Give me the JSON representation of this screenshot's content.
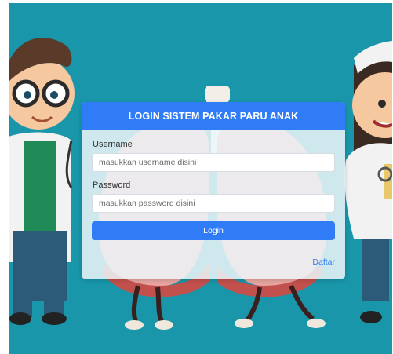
{
  "login": {
    "title": "LOGIN SISTEM PAKAR PARU ANAK",
    "username_label": "Username",
    "username_placeholder": "masukkan username disini",
    "password_label": "Password",
    "password_placeholder": "masukkan password disini",
    "login_button": "Login",
    "register_link": "Daftar"
  },
  "colors": {
    "background": "#1996aa",
    "accent": "#2f7cf6"
  }
}
